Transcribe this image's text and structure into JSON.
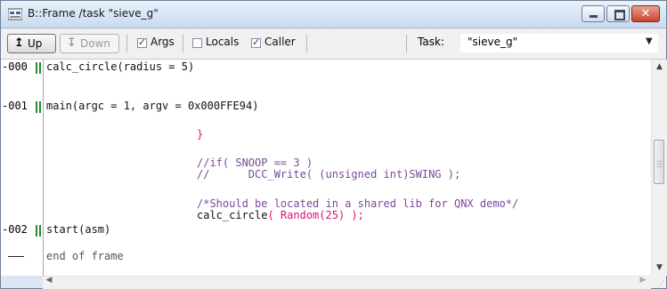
{
  "window": {
    "title": "B::Frame /task \"sieve_g\"",
    "close_glyph": "✕"
  },
  "toolbar": {
    "up_label": "Up",
    "down_label": "Down",
    "up_icon": "arrow-up-icon",
    "down_icon": "arrow-down-icon",
    "args_label": "Args",
    "args_checked": true,
    "locals_label": "Locals",
    "locals_checked": false,
    "caller_label": "Caller",
    "caller_checked": true,
    "task_label": "Task:",
    "task_value": "\"sieve_g\""
  },
  "frames": [
    {
      "level": "-000",
      "call": "calc_circle(radius = 5)"
    },
    {
      "level": "-001",
      "call": "main(argc = 1, argv = 0x000FFE94)"
    },
    {
      "level": "-002",
      "call": "start(asm)"
    }
  ],
  "caller_source": {
    "brace": "}",
    "line1": "//if( SNOOP == 3 )",
    "line2": "//      DCC_Write( (unsigned int)SWING );",
    "line3": "/*Should be located in a shared lib for QNX demo*/",
    "line4_fn": "calc_circle",
    "line4_args": "( Random(25) );"
  },
  "footer": {
    "end_text": "end of frame"
  },
  "colors": {
    "keyword_pink": "#e0107a",
    "comment_purple": "#7a4a9a",
    "gutter_green": "#2a8a2a"
  }
}
